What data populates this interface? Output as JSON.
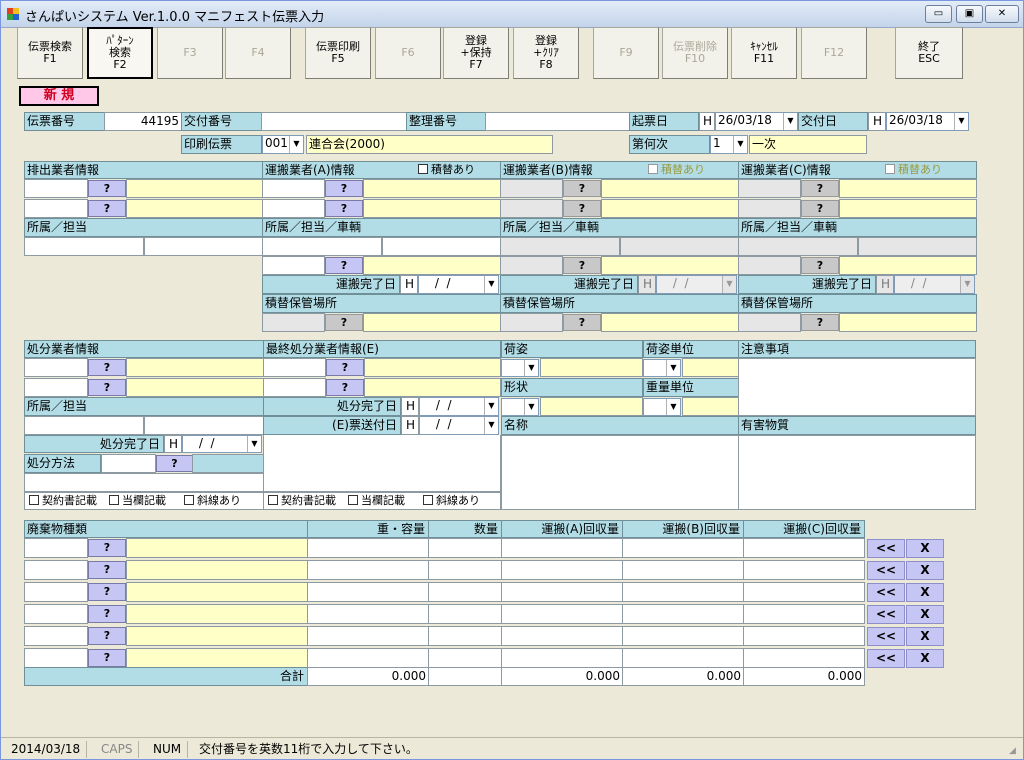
{
  "window": {
    "title": "さんぱいシステム Ver.1.0.0 マニフェスト伝票入力",
    "min": "▭",
    "max": "▣",
    "close": "✕"
  },
  "toolbar": {
    "keys": [
      {
        "label": "伝票検索\nF1",
        "enabled": true
      },
      {
        "label": "ﾊﾟﾀｰﾝ\n検索\nF2",
        "enabled": true
      },
      {
        "label": "F3",
        "enabled": false
      },
      {
        "label": "F4",
        "enabled": false
      },
      {
        "label": "伝票印刷\nF5",
        "enabled": true
      },
      {
        "label": "F6",
        "enabled": false
      },
      {
        "label": "登録\n+保持\nF7",
        "enabled": true
      },
      {
        "label": "登録\n+ｸﾘｱ\nF8",
        "enabled": true
      },
      {
        "label": "F9",
        "enabled": false
      },
      {
        "label": "伝票削除\nF10",
        "enabled": false
      },
      {
        "label": "ｷｬﾝｾﾙ\nF11",
        "enabled": true
      },
      {
        "label": "F12",
        "enabled": false
      },
      {
        "label": "終了\nESC",
        "enabled": true
      }
    ]
  },
  "mode": "新 規",
  "header": {
    "denpyo_no_label": "伝票番号",
    "denpyo_no": "44195",
    "kofu_no_label": "交付番号",
    "kofu_no": "",
    "seiri_no_label": "整理番号",
    "seiri_no": "",
    "kihyo_label": "起票日",
    "kihyo_era": "H",
    "kihyo_date": "26/03/18",
    "kofu_date_label": "交付日",
    "kofu_era": "H",
    "kofu_date": "26/03/18",
    "insatsu_label": "印刷伝票",
    "insatsu_code": "001",
    "insatsu_name": "連合会(2000)",
    "daiji_label": "第何次",
    "daiji_value": "1",
    "daiji_name": "一次"
  },
  "haishutsu": {
    "title": "排出業者情報",
    "shozoku": "所属／担当"
  },
  "unpan_a": {
    "title": "運搬業者(A)情報",
    "tsumikae": "積替あり",
    "shozoku": "所属／担当／車輌",
    "done": "運搬完了日",
    "era": "H",
    "date": " /  / ",
    "storage": "積替保管場所"
  },
  "unpan_b": {
    "title": "運搬業者(B)情報",
    "tsumikae": "積替あり",
    "shozoku": "所属／担当／車輌",
    "done": "運搬完了日",
    "era": "H",
    "date": " /  / ",
    "storage": "積替保管場所"
  },
  "unpan_c": {
    "title": "運搬業者(C)情報",
    "tsumikae": "積替あり",
    "shozoku": "所属／担当／車輌",
    "done": "運搬完了日",
    "era": "H",
    "date": " /  / ",
    "storage": "積替保管場所"
  },
  "shobun": {
    "title": "処分業者情報",
    "shozoku": "所属／担当",
    "done": "処分完了日",
    "era": "H",
    "date": " /  / ",
    "method": "処分方法"
  },
  "saishu": {
    "title": "最終処分業者情報(E)",
    "done": "処分完了日",
    "era": "H",
    "date": " /  / ",
    "e_sofu": "(E)票送付日",
    "e_era": "H",
    "e_date": " /  / "
  },
  "checks": {
    "keiyaku": "契約書記載",
    "tougai": "当欄記載",
    "shasen": "斜線あり"
  },
  "nisugata": {
    "label": "荷姿",
    "unit": "荷姿単位",
    "keijo": "形状",
    "weight_unit": "重量単位",
    "name": "名称",
    "caution": "注意事項",
    "hazard": "有害物質"
  },
  "waste": {
    "headers": {
      "kind": "廃棄物種類",
      "weight": "重・容量",
      "qty": "数量",
      "a": "運搬(A)回収量",
      "b": "運搬(B)回収量",
      "c": "運搬(C)回収量"
    },
    "rows": 6,
    "total_label": "合計",
    "totals": {
      "weight": "0.000",
      "a": "0.000",
      "b": "0.000",
      "c": "0.000"
    },
    "btn_left": "<<",
    "btn_x": "X"
  },
  "q": "?",
  "status": {
    "date": "2014/03/18",
    "caps": "CAPS",
    "num": "NUM",
    "message": "交付番号を英数11桁で入力して下さい。"
  }
}
